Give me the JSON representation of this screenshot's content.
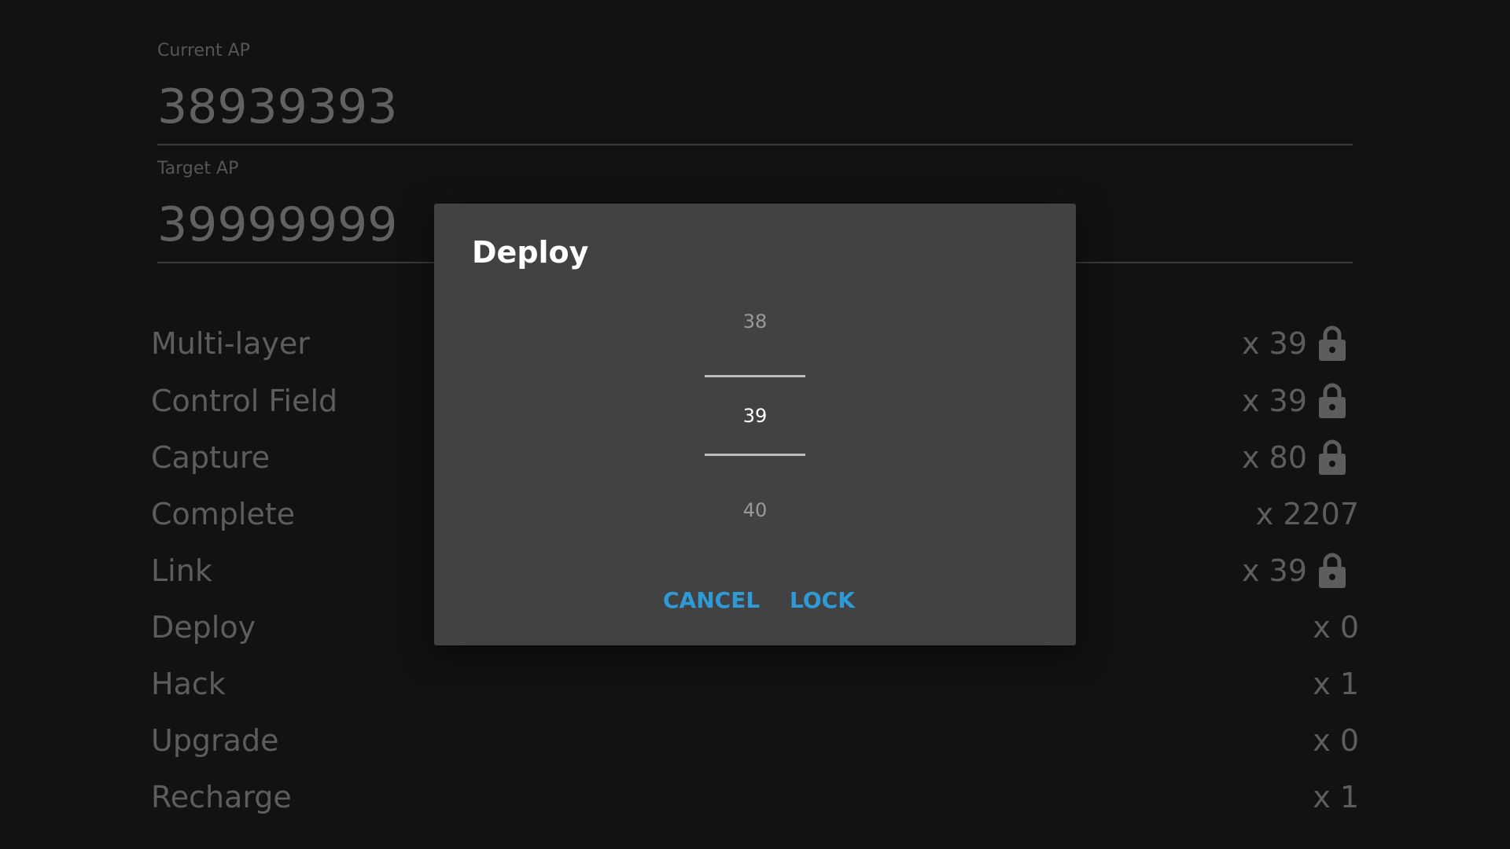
{
  "current_ap": {
    "label": "Current AP",
    "value": "38939393"
  },
  "target_ap": {
    "label": "Target AP",
    "value": "39999999"
  },
  "rows": [
    {
      "label": "Multi-layer",
      "count": "x 39",
      "locked": true
    },
    {
      "label": "Control Field",
      "count": "x 39",
      "locked": true
    },
    {
      "label": "Capture",
      "count": "x 80",
      "locked": true
    },
    {
      "label": "Complete",
      "count": "x 2207",
      "locked": false
    },
    {
      "label": "Link",
      "count": "x 39",
      "locked": true
    },
    {
      "label": "Deploy",
      "count": "x 0",
      "locked": false
    },
    {
      "label": "Hack",
      "count": "x 1",
      "locked": false
    },
    {
      "label": "Upgrade",
      "count": "x 0",
      "locked": false
    },
    {
      "label": "Recharge",
      "count": "x 1",
      "locked": false
    }
  ],
  "dialog": {
    "title": "Deploy",
    "picker": {
      "previous": "38",
      "current": "39",
      "next": "40"
    },
    "cancel_label": "CANCEL",
    "lock_label": "LOCK"
  },
  "icons": {
    "lock": "lock-icon"
  },
  "colors": {
    "accent": "#2e9bd8",
    "dialog_bg": "#424242",
    "page_bg": "#121212"
  }
}
